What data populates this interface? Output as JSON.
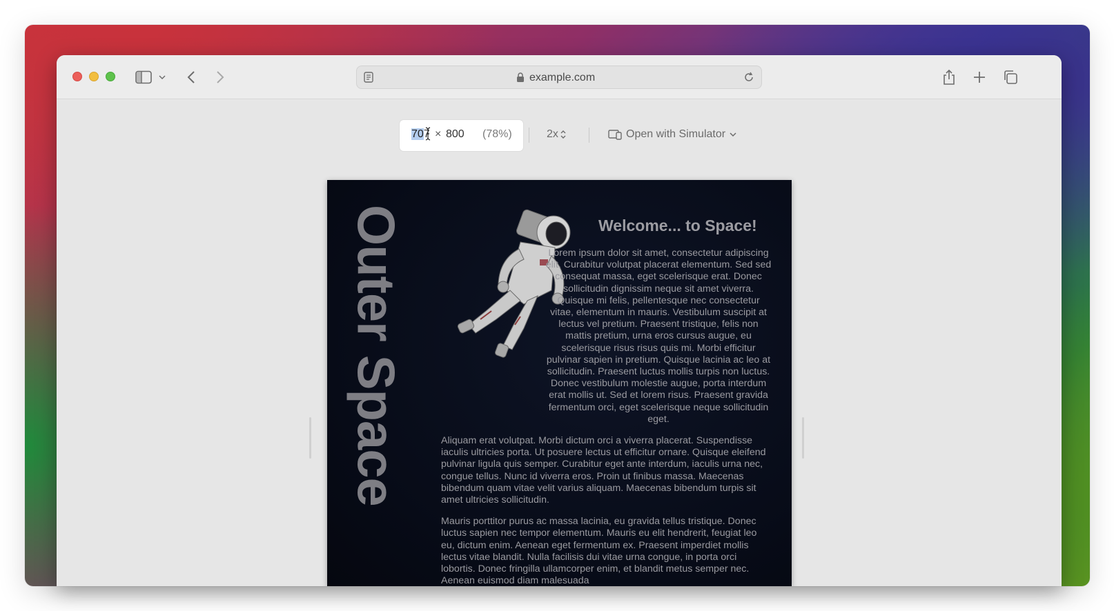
{
  "browser": {
    "url": "example.com"
  },
  "responsive_mode": {
    "width_selected": "70",
    "width_rest": "7",
    "times": "×",
    "height": "800",
    "zoom": "(78%)",
    "scale": "2x",
    "simulator_label": "Open with Simulator"
  },
  "page": {
    "side_title": "Outer Space",
    "heading": "Welcome... to Space!",
    "paragraphs": [
      "Lorem ipsum dolor sit amet, consectetur adipiscing elit. Curabitur volutpat placerat elementum. Sed sed consequat massa, eget scelerisque erat. Donec sollicitudin dignissim neque sit amet viverra. Quisque mi felis, pellentesque nec consectetur vitae, elementum in mauris. Vestibulum suscipit at lectus vel pretium. Praesent tristique, felis non mattis pretium, urna eros cursus augue, eu scelerisque risus risus quis mi. Morbi efficitur pulvinar sapien in pretium. Quisque lacinia ac leo at sollicitudin. Praesent luctus mollis turpis non luctus. Donec vestibulum molestie augue, porta interdum erat mollis ut. Sed et lorem risus. Praesent gravida fermentum orci, eget scelerisque neque sollicitudin eget.",
      "Aliquam erat volutpat. Morbi dictum orci a viverra placerat. Suspendisse iaculis ultricies porta. Ut posuere lectus ut efficitur ornare. Quisque eleifend pulvinar ligula quis semper. Curabitur eget ante interdum, iaculis urna nec, congue tellus. Nunc id viverra eros. Proin ut finibus massa. Maecenas bibendum quam vitae velit varius aliquam. Maecenas bibendum turpis sit amet ultricies sollicitudin.",
      "Mauris porttitor purus ac massa lacinia, eu gravida tellus tristique. Donec luctus sapien nec tempor elementum. Mauris eu elit hendrerit, feugiat leo eu, dictum enim. Aenean eget fermentum ex. Praesent imperdiet mollis lectus vitae blandit. Nulla facilisis dui vitae urna congue, in porta orci lobortis. Donec fringilla ullamcorper enim, et blandit metus semper nec. Aenean euismod diam malesuada"
    ]
  },
  "colors": {
    "close": "#ec5f5a",
    "minimize": "#f2be3f",
    "zoom": "#5ec24c",
    "selection": "#b4cdef"
  }
}
